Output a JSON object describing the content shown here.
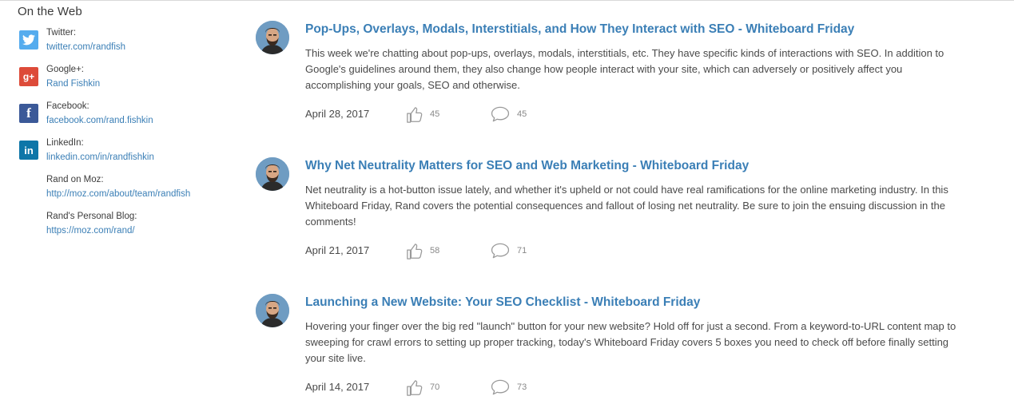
{
  "sidebar": {
    "heading": "On the Web",
    "profiles": [
      {
        "label": "Twitter:",
        "link": "twitter.com/randfish",
        "icon": "twitter-icon",
        "color": "#55acee"
      },
      {
        "label": "Google+:",
        "link": "Rand Fishkin",
        "icon": "google-plus-icon",
        "color": "#dd4b39"
      },
      {
        "label": "Facebook:",
        "link": "facebook.com/rand.fishkin",
        "icon": "facebook-icon",
        "color": "#3b5998"
      },
      {
        "label": "LinkedIn:",
        "link": "linkedin.com/in/randfishkin",
        "icon": "linkedin-icon",
        "color": "#0e76a8"
      },
      {
        "label": "Rand on Moz:",
        "link": "http://moz.com/about/team/randfish"
      },
      {
        "label": "Rand's Personal Blog:",
        "link": "https://moz.com/rand/"
      }
    ]
  },
  "icons": {
    "google_plus_glyph": "g+",
    "facebook_glyph": "f",
    "linkedin_glyph": "in"
  },
  "posts": [
    {
      "title": "Pop-Ups, Overlays, Modals, Interstitials, and How They Interact with SEO - Whiteboard Friday",
      "description": "This week we're chatting about pop-ups, overlays, modals, interstitials, etc. They have specific kinds of interactions with SEO. In addition to Google's guidelines around them, they also change how people interact with your site, which can adversely or positively affect you accomplishing your goals, SEO and otherwise.",
      "date": "April 28, 2017",
      "likes": "45",
      "comments": "45"
    },
    {
      "title": "Why Net Neutrality Matters for SEO and Web Marketing - Whiteboard Friday",
      "description": "Net neutrality is a hot-button issue lately, and whether it's upheld or not could have real ramifications for the online marketing industry. In this Whiteboard Friday, Rand covers the potential consequences and fallout of losing net neutrality. Be sure to join the ensuing discussion in the comments!",
      "date": "April 21, 2017",
      "likes": "58",
      "comments": "71"
    },
    {
      "title": "Launching a New Website: Your SEO Checklist - Whiteboard Friday",
      "description": "Hovering your finger over the big red \"launch\" button for your new website? Hold off for just a second. From a keyword-to-URL content map to sweeping for crawl errors to setting up proper tracking, today's Whiteboard Friday covers 5 boxes you need to check off before finally setting your site live.",
      "date": "April 14, 2017",
      "likes": "70",
      "comments": "73"
    }
  ],
  "colors": {
    "link": "#3b7fb6",
    "text": "#4a4a4a",
    "meta": "#888888"
  }
}
